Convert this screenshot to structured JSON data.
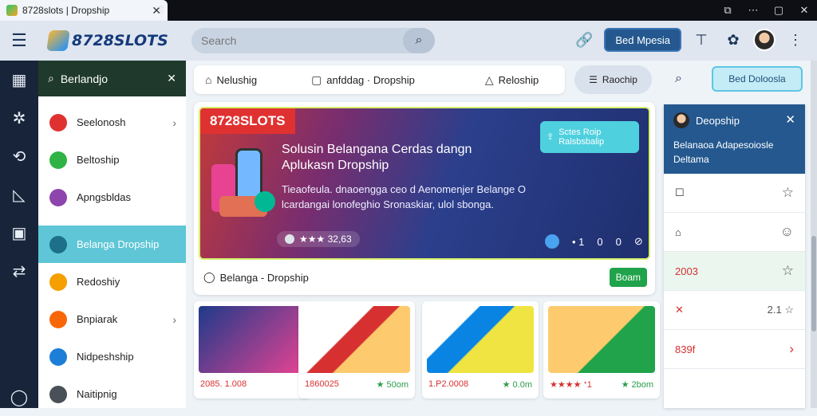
{
  "browser": {
    "tab_title": "8728slots | Dropship",
    "tab_close": "✕",
    "window_controls": [
      "⧉",
      "⋯",
      "▢",
      "✕"
    ]
  },
  "topbar": {
    "brand": "8728SLOTS",
    "search_placeholder": "Search",
    "action_button": "Bed Mpesia"
  },
  "sidebar": {
    "header": "Berlandjo",
    "items": [
      {
        "label": "Seelonosh",
        "color": "#e03131",
        "chevron": "›"
      },
      {
        "label": "Beltoship",
        "color": "#2fb344",
        "chevron": ""
      },
      {
        "label": "Apngsbldas",
        "color": "#8e44ad",
        "chevron": ""
      },
      {
        "label": "Belanga Dropship",
        "color": "#1d6f8a",
        "chevron": "",
        "active": true
      },
      {
        "label": "Redoshiy",
        "color": "#f59f00",
        "chevron": ""
      },
      {
        "label": "Bnpiarak",
        "color": "#f76707",
        "chevron": "›"
      },
      {
        "label": "Nidpeshship",
        "color": "#1c7ed6",
        "chevron": ""
      },
      {
        "label": "Naitipnig",
        "color": "#495057",
        "chevron": ""
      }
    ]
  },
  "subnav": {
    "items": [
      "Nelushig",
      "anfddag · Dropship",
      "Reloship"
    ],
    "pill": "Raochip",
    "dashboard_btn": "Bed Doloosla"
  },
  "hero": {
    "brand": "8728SLOTS",
    "title": "Solusin Belangana Cerdas dangn Aplukasn Dropship",
    "body": "Tieaofeula. dnaoengga ceo d Aenomenjer Belange O lcardangai lonofeghio Sronaskiar, ulol sbonga.",
    "stat": "★★★ 32,63",
    "controls": [
      "• 1",
      "0",
      "0",
      "⊘"
    ],
    "promo": "Sctes Roip Ralsbsbalip",
    "footer_label": "Belanga - Dropship",
    "footer_btn": "Boam"
  },
  "products": [
    {
      "price": "2085. 1.008",
      "rating": "",
      "colors": [
        "#1e3a8a",
        "#e84393"
      ]
    },
    {
      "price": "1860025",
      "rating": "★ 50om",
      "colors": [
        "#d63031",
        "#fdcb6e"
      ]
    },
    {
      "price": "1.P2.0008",
      "rating": "★ 0.0m",
      "colors": [
        "#0984e3",
        "#f0e442"
      ]
    },
    {
      "price": "★★★★ ᐩ1",
      "rating": "★ 2bom",
      "colors": [
        "#fdcb6e",
        "#20a34a"
      ]
    }
  ],
  "panel": {
    "title": "Deopship",
    "desc": "Belanaoa Adapesoiosle Deltama",
    "rows": [
      {
        "left": "☐",
        "right": "☆",
        "hl": false,
        "red": false
      },
      {
        "left": "⌂",
        "right": "☺",
        "hl": false,
        "red": false
      },
      {
        "left": "2003",
        "right": "☆",
        "hl": true,
        "red": true
      },
      {
        "left": "✕",
        "right": "2.1 ☆",
        "hl": false,
        "red": true
      },
      {
        "left": "839f",
        "right": "›",
        "hl": false,
        "red": true
      }
    ]
  }
}
